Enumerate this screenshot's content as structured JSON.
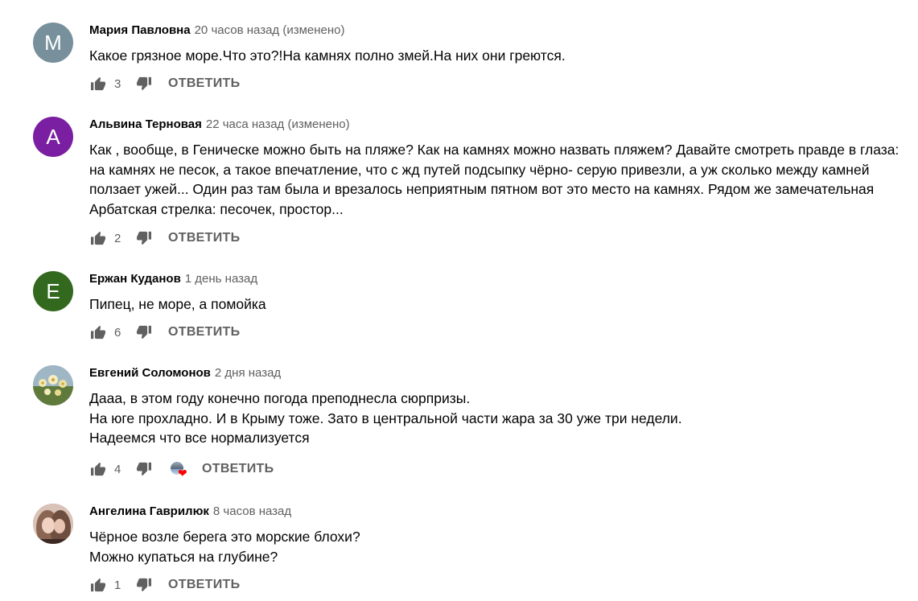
{
  "actions": {
    "reply_label": "ОТВЕТИТЬ"
  },
  "comments": [
    {
      "avatar_letter": "M",
      "avatar_color": "#78909c",
      "author": "Мария Павловна",
      "time": "20 часов назад (изменено)",
      "lines": [
        "Какое грязное море.Что это?!На камнях полно змей.На них они греются."
      ],
      "likes": "3"
    },
    {
      "avatar_letter": "A",
      "avatar_color": "#7b1fa2",
      "author": "Альвина Терновая",
      "time": "22 часа назад (изменено)",
      "lines": [
        "Как , вообще, в Геническе можно быть на пляже? Как на камнях можно назвать пляжем? Давайте смотреть правде в глаза: на камнях не песок, а такое впечатление, что с жд путей подсыпку чёрно- серую привезли, а уж сколько между камней ползает ужей... Один раз там была и врезалось неприятным пятном вот это место на камнях. Рядом же замечательная Арбатская стрелка: песочек, простор..."
      ],
      "likes": "2"
    },
    {
      "avatar_letter": "E",
      "avatar_color": "#33691e",
      "author": "Ержан Куданов",
      "time": "1 день назад",
      "lines": [
        "Пипец, не море, а помойка"
      ],
      "likes": "6"
    },
    {
      "avatar_letter": "",
      "avatar_color": "#8aa0a8",
      "author": "Евгений Соломонов",
      "time": "2 дня назад",
      "lines": [
        "Дааа, в этом году конечно погода преподнесла сюрпризы.",
        "На юге прохладно. И в Крыму тоже. Зато в центральной части жара за 30 уже три недели.",
        "Надеемся что все нормализуется"
      ],
      "likes": "4",
      "hearted": true
    },
    {
      "avatar_letter": "",
      "avatar_color": "#b89a8c",
      "author": "Ангелина Гаврилюк",
      "time": "8 часов назад",
      "lines": [
        "Чёрное возле берега это морские блохи?",
        "Можно купаться на глубине?"
      ],
      "likes": "1"
    }
  ]
}
